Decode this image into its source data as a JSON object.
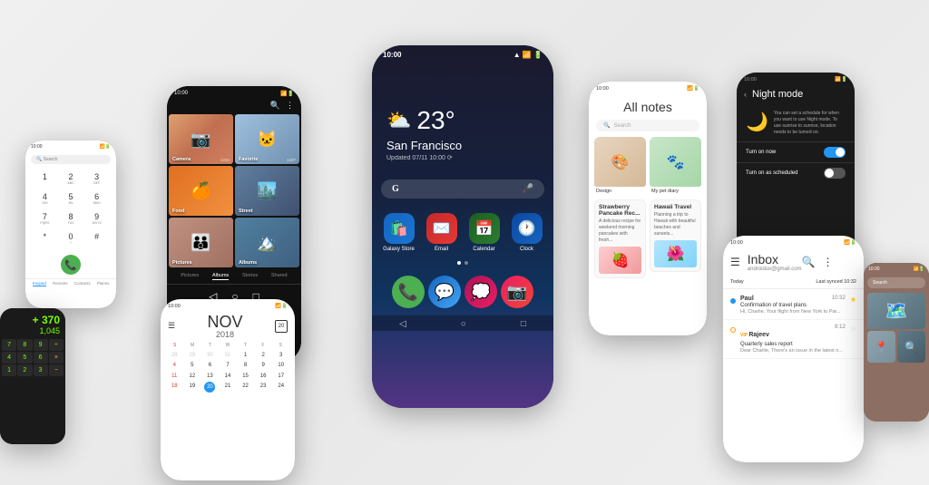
{
  "scene": {
    "bg": "#f0f0f0"
  },
  "phones": {
    "center": {
      "time": "10:00",
      "weather": {
        "temp": "23°",
        "city": "San Francisco",
        "updated": "Updated 07/11 10:00 ⟳",
        "icon": "⛅"
      },
      "apps": [
        {
          "label": "Galaxy Store",
          "icon": "🛍️",
          "color": "app-galaxy"
        },
        {
          "label": "Email",
          "icon": "✉️",
          "color": "app-email"
        },
        {
          "label": "Calendar",
          "icon": "📅",
          "color": "app-calendar"
        },
        {
          "label": "Clock",
          "icon": "🕐",
          "color": "app-clock"
        }
      ],
      "dock": [
        {
          "icon": "📞",
          "color": "dock-phone"
        },
        {
          "icon": "💬",
          "color": "dock-msg"
        },
        {
          "icon": "💭",
          "color": "dock-bubbles"
        },
        {
          "icon": "📷",
          "color": "dock-camera"
        }
      ]
    },
    "dialer": {
      "time": "10:00",
      "search_placeholder": "Search",
      "keys": [
        "1",
        "2",
        "3",
        "4",
        "5",
        "6",
        "7",
        "8",
        "9",
        "*",
        "0",
        "#"
      ],
      "letters": [
        "",
        "ABC",
        "DEF",
        "GHI",
        "JKL",
        "MNO",
        "PQRS",
        "TUV",
        "WXYZ",
        "",
        "+ ",
        ""
      ],
      "tabs": [
        "Keypad",
        "Recents",
        "Contacts",
        "Places"
      ]
    },
    "gallery": {
      "time": "10:00",
      "items": [
        {
          "label": "Camera",
          "count": "1234"
        },
        {
          "label": "Favorite",
          "count": "1327"
        },
        {
          "label": "Food",
          "count": ""
        },
        {
          "label": "Street",
          "count": ""
        },
        {
          "label": "Pictures",
          "count": ""
        },
        {
          "label": "Albums",
          "count": ""
        }
      ],
      "tabs": [
        "Pictures",
        "Albums",
        "Stories",
        "Shared"
      ]
    },
    "calendar": {
      "time": "10:00",
      "month": "NOV",
      "year": "2018",
      "badge": "20",
      "days": [
        "S",
        "M",
        "T",
        "W",
        "T",
        "F",
        "S"
      ],
      "dates": [
        "28",
        "29",
        "30",
        "31",
        "1",
        "2",
        "3",
        "4",
        "5",
        "6",
        "7",
        "8",
        "9",
        "10",
        "11",
        "12",
        "13",
        "14",
        "15",
        "16",
        "17",
        "18",
        "19",
        "20",
        "21",
        "22",
        "23",
        "24"
      ]
    },
    "notes": {
      "time": "10:00",
      "title": "All notes",
      "cards": [
        {
          "title": "Design",
          "type": "img"
        },
        {
          "title": "My pet diary",
          "type": "img"
        },
        {
          "title": "Strawberry Pancake Rec...",
          "type": "img"
        },
        {
          "title": "Hawaii Travel",
          "type": "img"
        }
      ]
    },
    "night": {
      "time": "10:00",
      "title": "Night mode",
      "description": "You can set a schedule for when you want to use Night mode. To use sunrise to sunrise, location needs to be turned on.",
      "options": [
        {
          "text": "Turn on now",
          "on": true
        },
        {
          "text": "Turn on as scheduled",
          "on": false
        }
      ]
    },
    "email": {
      "time": "10:00",
      "inbox": "Inbox",
      "address": "androidux@gmail.com",
      "today": "Today",
      "synced": "Last synced 10:32",
      "messages": [
        {
          "name": "Paul",
          "time": "10:32",
          "subject": "Confirmation of travel plans",
          "preview": "Hi, Charlie. Your flight from New York to Par...",
          "unread": true,
          "starred": true,
          "vip": false
        },
        {
          "name": "Rajeev",
          "time": "8:12",
          "subject": "Quarterly sales report",
          "preview": "Dear Charlie, There's an issue in the latest n...",
          "unread": false,
          "starred": false,
          "vip": true
        }
      ]
    }
  }
}
